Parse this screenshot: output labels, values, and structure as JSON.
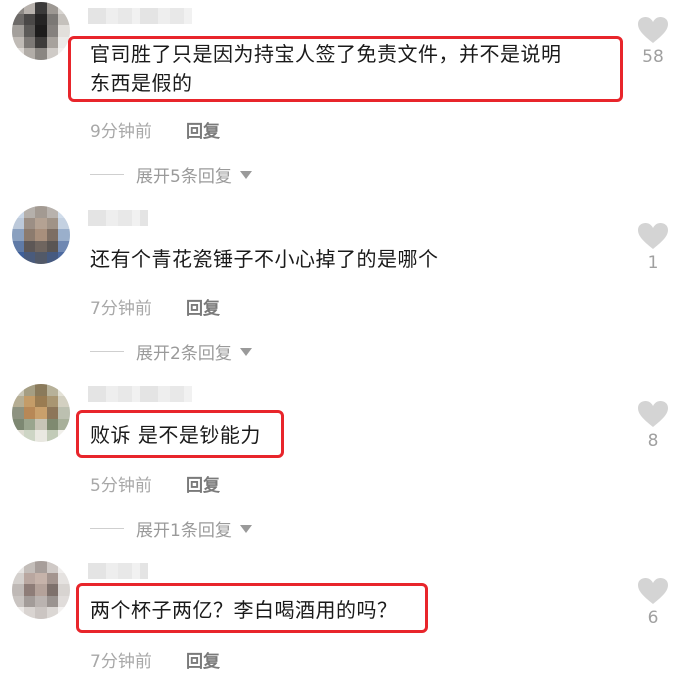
{
  "comments": [
    {
      "text_line1": "官司胜了只是因为持宝人签了免责文件，并不是说明",
      "text_line2": "东西是假的",
      "time": "9分钟前",
      "reply_label": "回复",
      "expand_label": "展开5条回复",
      "likes": "58",
      "highlighted": true
    },
    {
      "text_line1": "还有个青花瓷锤子不小心掉了的是哪个",
      "time": "7分钟前",
      "reply_label": "回复",
      "expand_label": "展开2条回复",
      "likes": "1",
      "highlighted": false
    },
    {
      "text_line1": "败诉 是不是钞能力",
      "time": "5分钟前",
      "reply_label": "回复",
      "expand_label": "展开1条回复",
      "likes": "8",
      "highlighted": true
    },
    {
      "text_line1": "两个杯子两亿？李白喝酒用的吗？",
      "time": "7分钟前",
      "reply_label": "回复",
      "likes": "6",
      "highlighted": true
    }
  ],
  "colors": {
    "highlight": "#e8252b",
    "like_icon": "#d4d4d4",
    "meta_text": "#a8a8a8"
  },
  "icons": {
    "like": "heart-icon",
    "expand": "triangle-down-icon"
  }
}
